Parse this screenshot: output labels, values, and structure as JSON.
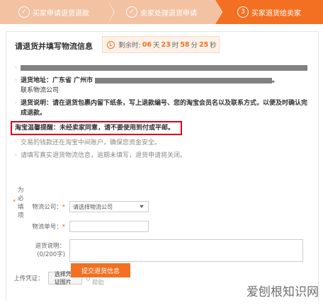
{
  "steps": [
    {
      "icon": "check-icon",
      "label": "买家申请退货退款",
      "state": "done"
    },
    {
      "icon": "check-icon",
      "label": "卖家处理退货申请",
      "state": "done"
    },
    {
      "icon": "3",
      "label": "买家退货给卖家",
      "state": "active"
    }
  ],
  "panel": {
    "title": "请退货并填写物流信息",
    "timer": {
      "prefix": "剩余时:",
      "days": "06",
      "day_unit": "天",
      "hours": "23",
      "hour_unit": "时",
      "minutes": "58",
      "minute_unit": "分",
      "seconds": "25",
      "second_unit": "秒"
    }
  },
  "info": {
    "address_label": "退货地址：",
    "address_value": "广东省 广州市",
    "address_tail": "。",
    "contact": "联系物流公司",
    "note_label": "退货说明：",
    "note_value": "请在退货包裹内留下纸条，写上退款编号、您的淘宝会员名以及联系方式，以便及时确认完成退款。",
    "warn_label": "淘宝温馨提醒：",
    "warn_value": "未经卖家同意，请不要使用到付或平邮。",
    "tip1": "交易的钱款还在淘宝中间账户，确保您资金安全。",
    "tip2": "请填写真实退货物流信息，逾期未填写，退货申请将关闭。"
  },
  "form": {
    "required_note": "为必填项",
    "carrier_label": "物流公司：",
    "carrier_value": "请选择物流公司",
    "tracking_label": "物流单号：",
    "desc_label": "退货说明：",
    "desc_count": "(0/200字)",
    "upload_label": "上传凭证：",
    "upload_button": "选择凭证图片",
    "upload_help": "上传帮助",
    "submit": "提交退货信息"
  },
  "watermark": "爱刨根知识网"
}
